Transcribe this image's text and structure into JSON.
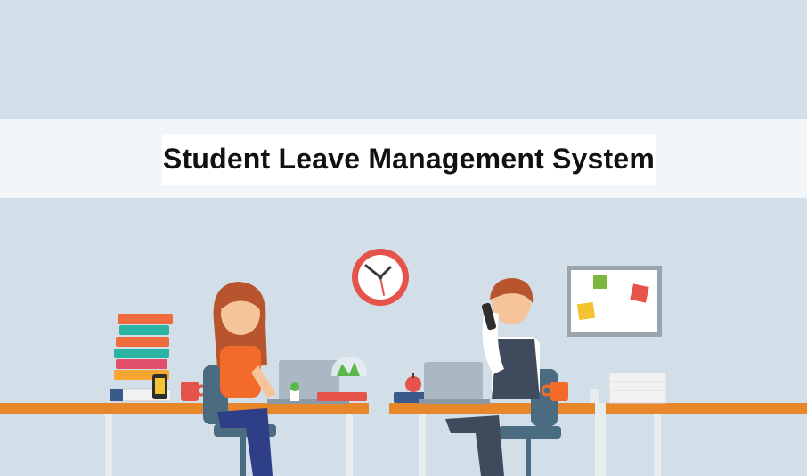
{
  "banner": {
    "title": "Student Leave Management System"
  },
  "illustration": {
    "icons": [
      "wall-clock-icon",
      "bulletin-board-icon",
      "book-stack-icon",
      "laptop-icon",
      "phone-icon",
      "mug-icon",
      "apple-icon",
      "plant-terrarium-icon",
      "paper-stack-icon"
    ],
    "colors": {
      "background": "#d3dfe8",
      "banner": "#f3f6f8",
      "desk": "#e8872a",
      "clock_rim": "#e5534b"
    }
  }
}
